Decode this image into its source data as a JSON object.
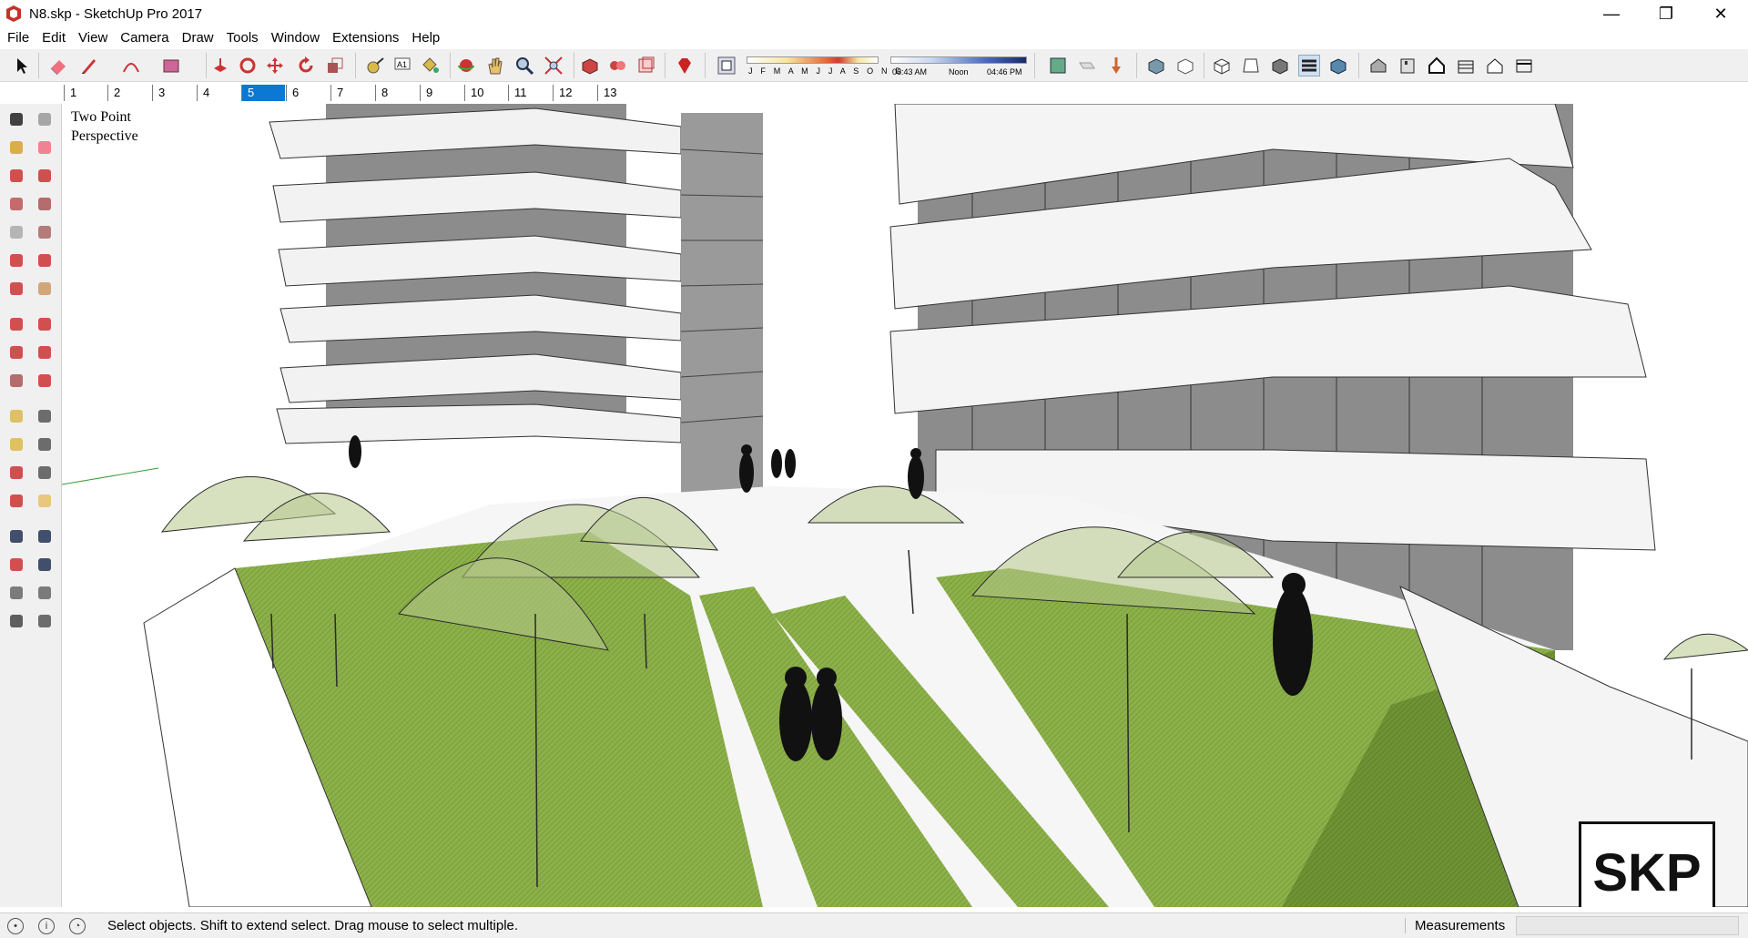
{
  "window": {
    "title": "N8.skp - SketchUp Pro 2017",
    "minimize_glyph": "—",
    "maximize_glyph": "❐",
    "close_glyph": "✕"
  },
  "menu": [
    "File",
    "Edit",
    "View",
    "Camera",
    "Draw",
    "Tools",
    "Window",
    "Extensions",
    "Help"
  ],
  "shadow_settings": {
    "months": "J F M A M J J A S O N D",
    "time_start": "06:43 AM",
    "time_mid": "Noon",
    "time_end": "04:46 PM"
  },
  "scenes": {
    "tabs": [
      "1",
      "2",
      "3",
      "4",
      "5",
      "6",
      "7",
      "8",
      "9",
      "10",
      "11",
      "12",
      "13"
    ],
    "active_index": 4
  },
  "viewport": {
    "camera_mode": "Two Point Perspective",
    "watermark": "SKP",
    "colors": {
      "grass": "#8cb04a",
      "grass_dark": "#6e9234",
      "facade_glass": "#8c8c8c",
      "slab": "#f4f4f4",
      "tree": "#b7c98c"
    }
  },
  "statusbar": {
    "message": "Select objects. Shift to extend select. Drag mouse to select multiple.",
    "measurements_label": "Measurements",
    "measurements_value": ""
  },
  "icons": {
    "toolbar": [
      "select-arrow-icon",
      "eraser-icon",
      "pencil-icon",
      "arc-icon",
      "rectangle-icon",
      "push-pull-icon",
      "follow-me-icon",
      "move-icon",
      "rotate-icon",
      "scale-icon",
      "tape-measure-icon",
      "text-icon",
      "paint-bucket-icon",
      "orbit-icon",
      "pan-icon",
      "zoom-icon",
      "zoom-extents-icon",
      "3d-warehouse-icon",
      "extension-warehouse-icon",
      "layout-icon",
      "ruby-icon",
      "shadows-icon",
      "soften-edges-icon",
      "fog-icon",
      "section-icon",
      "xray-icon",
      "wireframe-icon",
      "hidden-line-icon",
      "shaded-icon",
      "textured-icon",
      "monochrome-icon",
      "iso-view-icon",
      "top-view-icon",
      "front-view-icon",
      "right-view-icon",
      "back-view-icon",
      "left-view-icon"
    ],
    "left": [
      "select-icon",
      "component-icon",
      "paint-icon",
      "eraser-icon",
      "line-icon",
      "freehand-icon",
      "rectangle-icon",
      "rotated-rect-icon",
      "circle-icon",
      "polygon-icon",
      "arc-icon",
      "2pt-arc-icon",
      "3pt-arc-icon",
      "pie-icon",
      "move-icon",
      "push-pull-icon",
      "rotate-icon",
      "follow-me-icon",
      "scale-icon",
      "offset-icon",
      "tape-icon",
      "dimension-icon",
      "protractor-icon",
      "text-icon",
      "axes-icon",
      "3d-text-icon",
      "orbit-icon",
      "pan-icon",
      "zoom-icon",
      "zoom-window-icon",
      "zoom-extents-icon",
      "previous-icon",
      "position-camera-icon",
      "look-around-icon",
      "walk-icon",
      "section-plane-icon"
    ]
  }
}
